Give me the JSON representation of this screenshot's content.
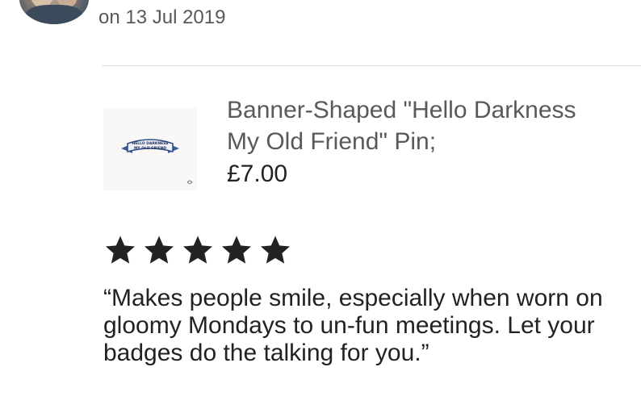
{
  "review": {
    "date": "on 13 Jul 2019",
    "rating": 5,
    "rating_max": 5,
    "text": "“Makes people smile, especially when worn on gloomy Mondays to un-fun meetings. Let your badges do the talking for you.”"
  },
  "product": {
    "title": "Banner-Shaped \"Hello Darkness My Old Friend\" Pin;",
    "price": "£7.00",
    "thumbnail_banner_text": "HELLO DARKNESS MY OLD FRIEND"
  },
  "icons": {
    "star": "star-icon",
    "avatar": "reviewer-avatar"
  },
  "colors": {
    "star": "#222222",
    "secondary_text": "#595959",
    "divider": "#e1e1e1"
  }
}
